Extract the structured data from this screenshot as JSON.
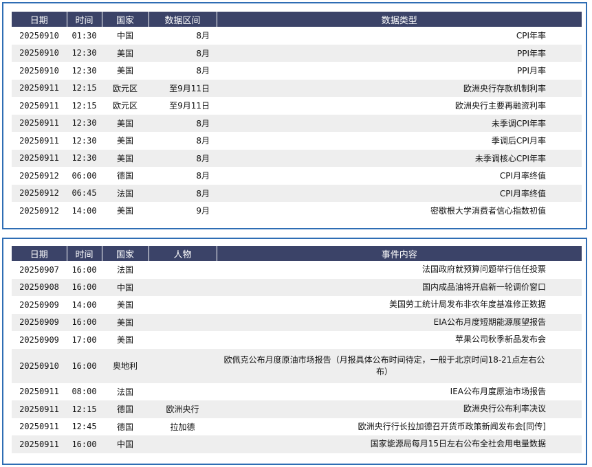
{
  "data_table": {
    "headers": [
      "日期",
      "时间",
      "国家",
      "数据区间",
      "数据类型"
    ],
    "rows": [
      {
        "date": "20250910",
        "time": "01:30",
        "country": "中国",
        "period": "8月",
        "type": "CPI年率"
      },
      {
        "date": "20250910",
        "time": "12:30",
        "country": "美国",
        "period": "8月",
        "type": "PPI年率"
      },
      {
        "date": "20250910",
        "time": "12:30",
        "country": "美国",
        "period": "8月",
        "type": "PPI月率"
      },
      {
        "date": "20250911",
        "time": "12:15",
        "country": "欧元区",
        "period": "至9月11日",
        "type": "欧洲央行存款机制利率"
      },
      {
        "date": "20250911",
        "time": "12:15",
        "country": "欧元区",
        "period": "至9月11日",
        "type": "欧洲央行主要再融资利率"
      },
      {
        "date": "20250911",
        "time": "12:30",
        "country": "美国",
        "period": "8月",
        "type": "未季调CPI年率"
      },
      {
        "date": "20250911",
        "time": "12:30",
        "country": "美国",
        "period": "8月",
        "type": "季调后CPI月率"
      },
      {
        "date": "20250911",
        "time": "12:30",
        "country": "美国",
        "period": "8月",
        "type": "未季调核心CPI年率"
      },
      {
        "date": "20250912",
        "time": "06:00",
        "country": "德国",
        "period": "8月",
        "type": "CPI月率终值"
      },
      {
        "date": "20250912",
        "time": "06:45",
        "country": "法国",
        "period": "8月",
        "type": "CPI月率终值"
      },
      {
        "date": "20250912",
        "time": "14:00",
        "country": "美国",
        "period": "9月",
        "type": "密歇根大学消费者信心指数初值"
      }
    ]
  },
  "event_table": {
    "headers": [
      "日期",
      "时间",
      "国家",
      "人物",
      "事件内容"
    ],
    "rows": [
      {
        "date": "20250907",
        "time": "16:00",
        "country": "法国",
        "person": "",
        "event": "法国政府就预算问题举行信任投票"
      },
      {
        "date": "20250908",
        "time": "16:00",
        "country": "中国",
        "person": "",
        "event": "国内成品油将开启新一轮调价窗口"
      },
      {
        "date": "20250909",
        "time": "14:00",
        "country": "美国",
        "person": "",
        "event": "美国劳工统计局发布非农年度基准修正数据"
      },
      {
        "date": "20250909",
        "time": "16:00",
        "country": "美国",
        "person": "",
        "event": "EIA公布月度短期能源展望报告"
      },
      {
        "date": "20250909",
        "time": "17:00",
        "country": "美国",
        "person": "",
        "event": "苹果公司秋季新品发布会"
      },
      {
        "date": "20250910",
        "time": "16:00",
        "country": "奥地利",
        "person": "",
        "event": "欧佩克公布月度原油市场报告（月报具体公布时间待定，一般于北京时间18-21点左右公布）"
      },
      {
        "date": "20250911",
        "time": "08:00",
        "country": "法国",
        "person": "",
        "event": "IEA公布月度原油市场报告"
      },
      {
        "date": "20250911",
        "time": "12:15",
        "country": "德国",
        "person": "欧洲央行",
        "event": "欧洲央行公布利率决议"
      },
      {
        "date": "20250911",
        "time": "12:45",
        "country": "德国",
        "person": "拉加德",
        "event": "欧洲央行行长拉加德召开货币政策新闻发布会[同传]"
      },
      {
        "date": "20250911",
        "time": "16:00",
        "country": "中国",
        "person": "",
        "event": "国家能源局每月15日左右公布全社会用电量数据"
      }
    ]
  }
}
